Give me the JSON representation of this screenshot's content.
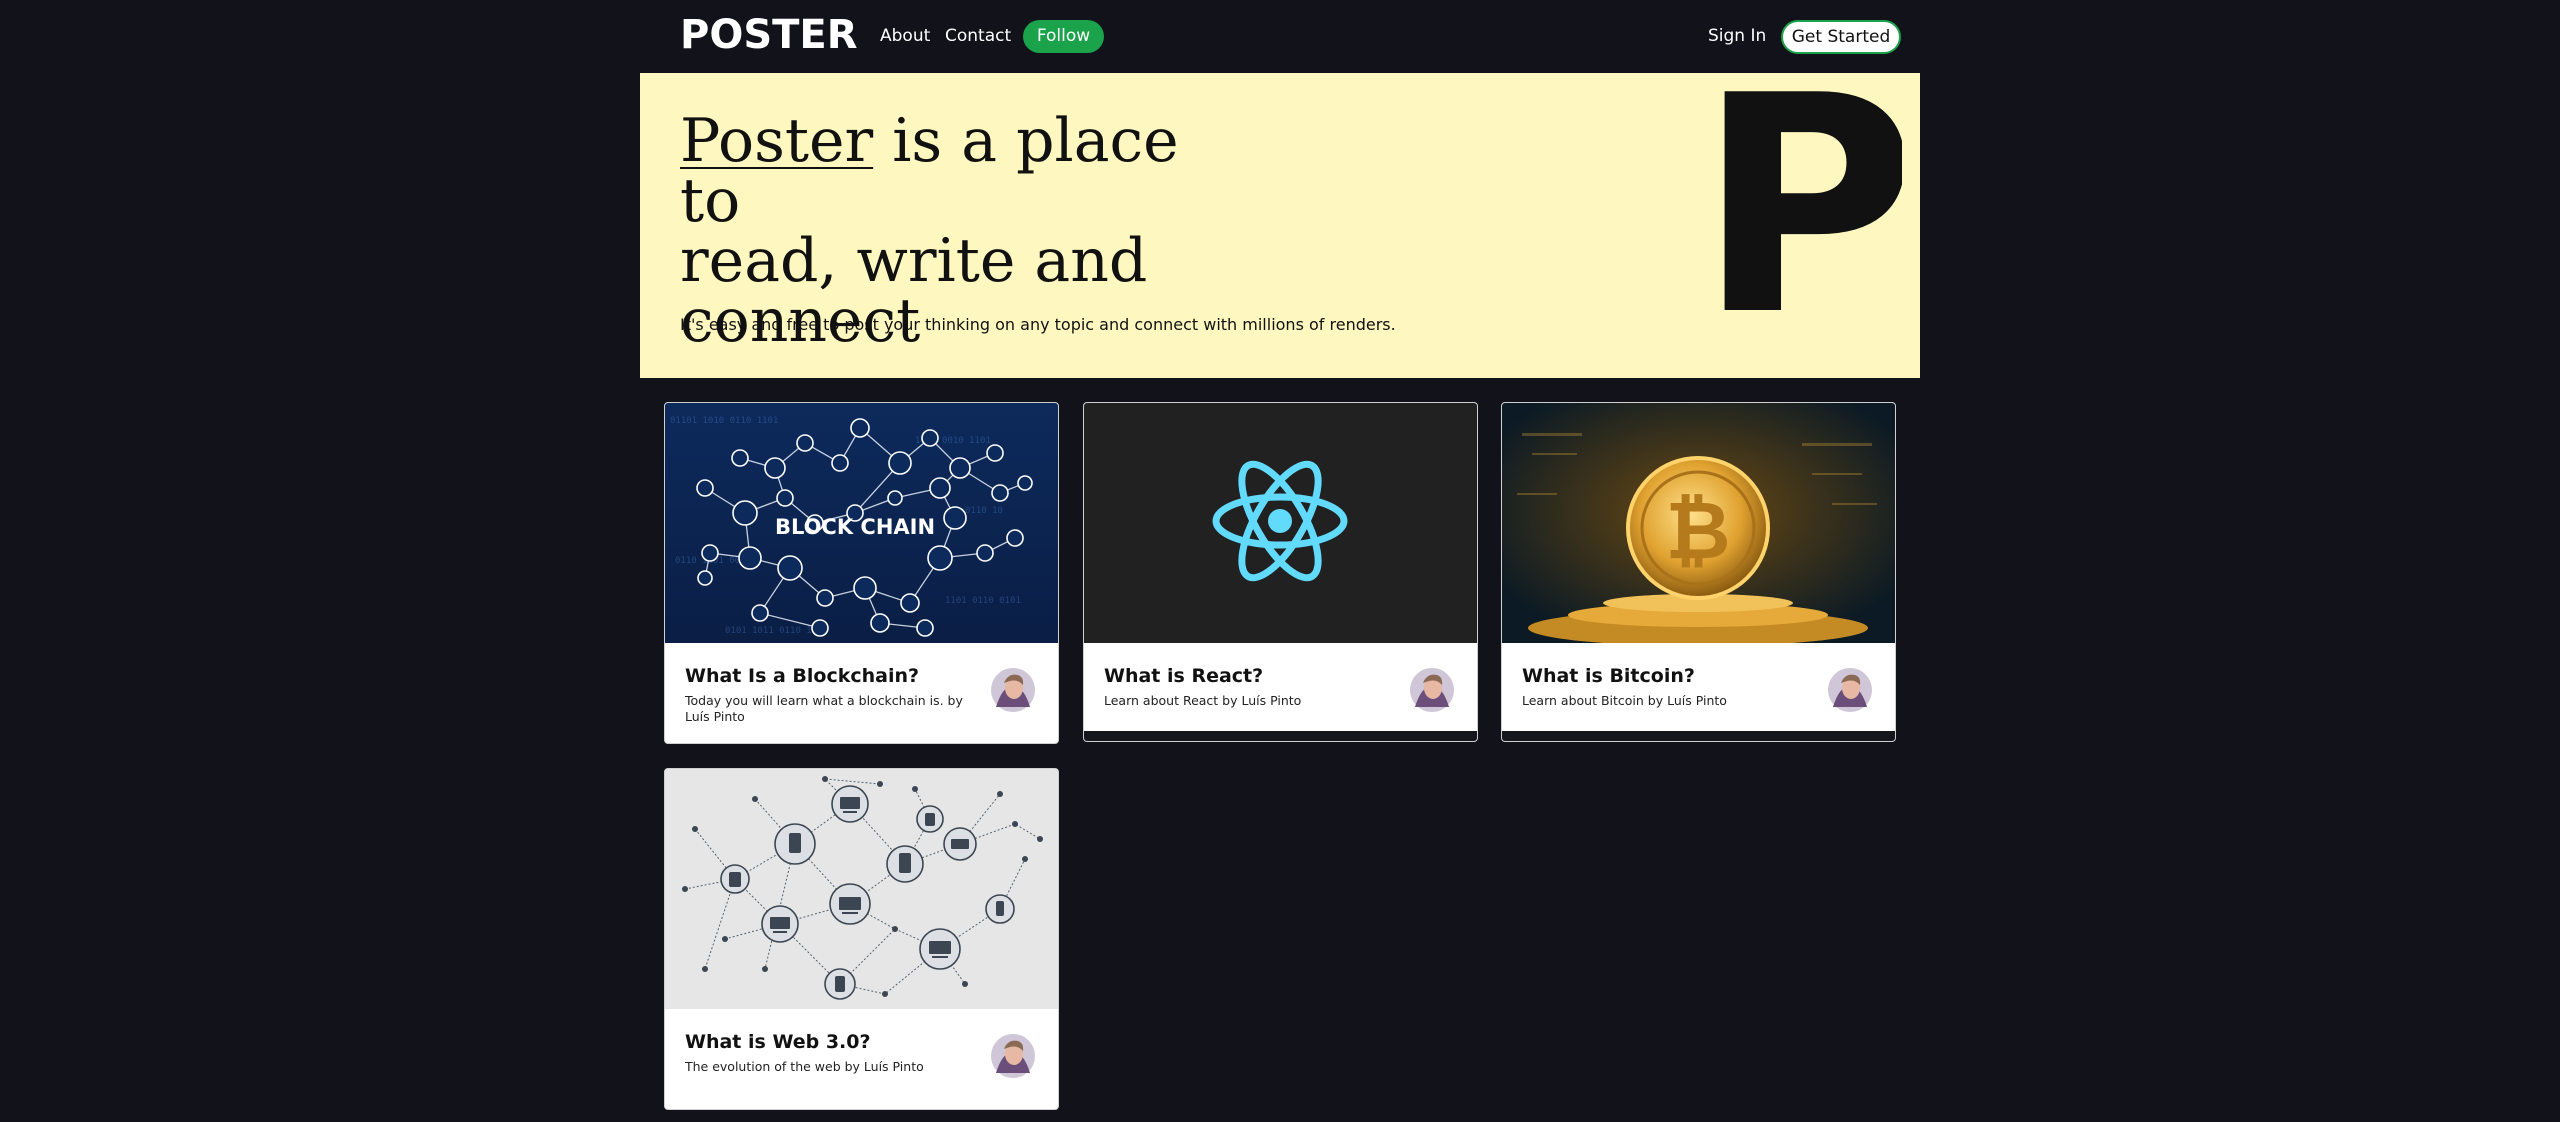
{
  "nav": {
    "logo": "POSTER",
    "links": [
      "About",
      "Contact"
    ],
    "follow_label": "Follow",
    "signin_label": "Sign In",
    "get_started_label": "Get Started"
  },
  "hero": {
    "title_highlight": "Poster",
    "title_rest_line1": " is a place to",
    "title_line2": "read, write and",
    "title_line3": "connect",
    "subtitle": "It's easy and free to post your thinking on any topic and connect with millions of renders.",
    "big_letter": "P"
  },
  "posts": [
    {
      "title": "What Is a Blockchain?",
      "description": "Today you will learn what a blockchain is. by Luís Pinto",
      "image_text": "BLOCK CHAIN",
      "image": "blockchain-network"
    },
    {
      "title": "What is React?",
      "description": "Learn about React by Luís Pinto",
      "image": "react-logo"
    },
    {
      "title": "What is Bitcoin?",
      "description": "Learn about Bitcoin by Luís Pinto",
      "image_text": "₿",
      "image": "bitcoin-coin"
    },
    {
      "title": "What is Web 3.0?",
      "description": "The evolution of the web by Luís Pinto",
      "image": "device-network"
    }
  ],
  "colors": {
    "page_bg": "#11121a",
    "hero_bg": "#fef8c0",
    "accent_green": "#1aa34a",
    "react_blue": "#61dafb",
    "bitcoin_gold": "#f0b43a"
  }
}
